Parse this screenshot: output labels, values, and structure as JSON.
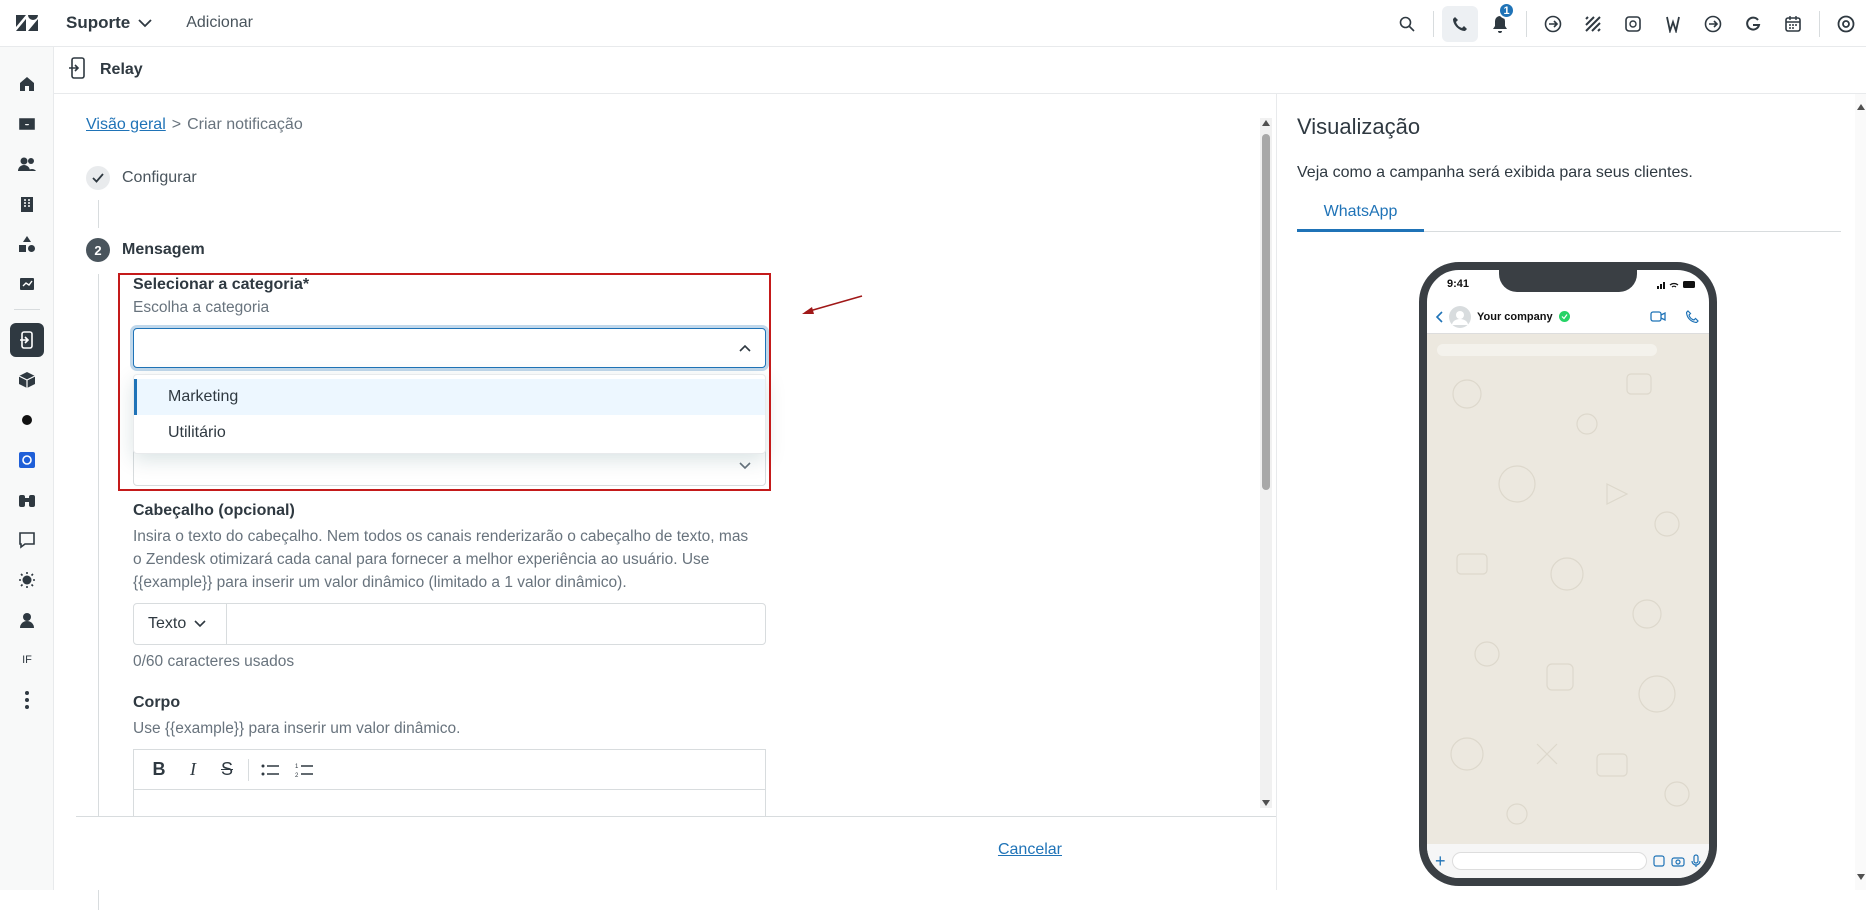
{
  "topbar": {
    "product": "Suporte",
    "add_label": "Adicionar",
    "notification_count": "1",
    "icons": [
      "search-icon",
      "phone-icon",
      "bell-icon",
      "app-icon-1",
      "app-icon-2",
      "app-icon-3",
      "app-icon-4",
      "app-icon-5",
      "app-icon-6",
      "calendar-icon",
      "help-icon"
    ]
  },
  "leftnav": {
    "items": [
      "home-icon",
      "inbox-icon",
      "users-icon",
      "organizations-icon",
      "shapes-icon",
      "reporting-icon",
      "relay-icon",
      "box-icon",
      "dot-icon",
      "app-icon",
      "binoculars-icon",
      "chat-icon",
      "sun-icon",
      "agent-icon",
      "initials",
      "more-icon"
    ],
    "initials_label": "IF"
  },
  "app": {
    "name": "Relay"
  },
  "breadcrumb": {
    "link": "Visão geral",
    "separator": ">",
    "current": "Criar notificação"
  },
  "steps": {
    "configure": "Configurar",
    "message_number": "2",
    "message": "Mensagem"
  },
  "category": {
    "label": "Selecionar a categoria*",
    "hint": "Escolha a categoria",
    "value": "",
    "options": [
      "Marketing",
      "Utilitário"
    ]
  },
  "header_section": {
    "label": "Cabeçalho (opcional)",
    "hint_line1": "Insira o texto do cabeçalho. Nem todos os canais renderizarão o cabeçalho de texto, mas",
    "hint_line2": "o Zendesk otimizará cada canal para fornecer a melhor experiência ao usuário. Use",
    "hint_line3": "{{example}} para inserir um valor dinâmico (limitado a 1 valor dinâmico).",
    "type": "Texto",
    "counter": "0/60 caracteres usados"
  },
  "body_section": {
    "label": "Corpo",
    "hint": "Use {{example}} para inserir um valor dinâmico.",
    "toolbar": {
      "bold": "B",
      "italic": "I",
      "strike": "S"
    }
  },
  "footer": {
    "cancel": "Cancelar"
  },
  "preview": {
    "title": "Visualização",
    "subtitle": "Veja como a campanha será exibida para seus clientes.",
    "tab": "WhatsApp",
    "phone_time": "9:41",
    "contact": "Your company"
  },
  "colors": {
    "accent": "#1f73b7",
    "annotation": "#c41a1a"
  }
}
